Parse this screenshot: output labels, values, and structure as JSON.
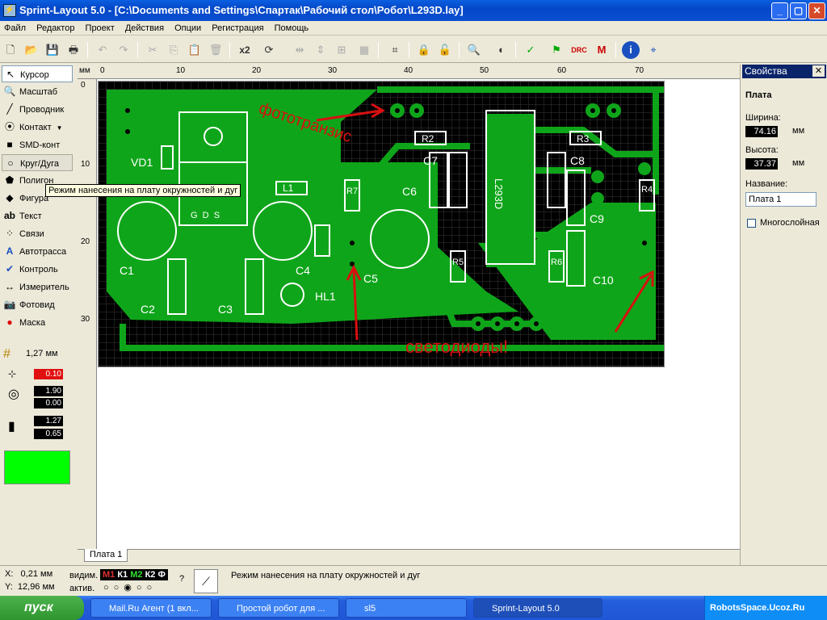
{
  "window": {
    "title": "Sprint-Layout 5.0 - [C:\\Documents and Settings\\Спартак\\Рабочий стол\\Робот\\L293D.lay]",
    "app_icon": "pcb-icon"
  },
  "menu": [
    "Файл",
    "Редактор",
    "Проект",
    "Действия",
    "Опции",
    "Регистрация",
    "Помощь"
  ],
  "toolbar": {
    "zoom_label": "x2"
  },
  "tools": [
    {
      "label": "Курсор",
      "icon": "cursor-icon",
      "glyph": "↖"
    },
    {
      "label": "Масштаб",
      "icon": "zoom-icon",
      "glyph": "🔍"
    },
    {
      "label": "Проводник",
      "icon": "track-icon",
      "glyph": "╱"
    },
    {
      "label": "Контакт",
      "icon": "pad-icon",
      "glyph": "⦿"
    },
    {
      "label": "SMD-конт",
      "icon": "smd-icon",
      "glyph": "■"
    },
    {
      "label": "Круг/Дуга",
      "icon": "circle-icon",
      "glyph": "○"
    },
    {
      "label": "Полигон",
      "icon": "polygon-icon",
      "glyph": "⬟"
    },
    {
      "label": "Фигура",
      "icon": "shape-icon",
      "glyph": "◆"
    },
    {
      "label": "Текст",
      "icon": "text-icon",
      "glyph": "ab"
    },
    {
      "label": "Связи",
      "icon": "connections-icon",
      "glyph": "⁘"
    },
    {
      "label": "Автотрасса",
      "icon": "autoroute-icon",
      "glyph": "A"
    },
    {
      "label": "Контроль",
      "icon": "check-icon",
      "glyph": "✔"
    },
    {
      "label": "Измеритель",
      "icon": "measure-icon",
      "glyph": "↔"
    },
    {
      "label": "Фотовид",
      "icon": "camera-icon",
      "glyph": "📷"
    },
    {
      "label": "Маска",
      "icon": "mask-icon",
      "glyph": "●"
    }
  ],
  "tooltip": "Режим нанесения на плату окружностей и дуг",
  "grid": {
    "value": "1,27 мм"
  },
  "params": {
    "track_width": "0.10",
    "pad_outer": "1.90",
    "pad_inner": "0.00",
    "smd_w": "1.27",
    "smd_h": "0.65"
  },
  "layer_color": "#00ff00",
  "ruler": {
    "unit": "мм",
    "ticks": [
      "0",
      "10",
      "20",
      "30",
      "40",
      "50",
      "60",
      "70"
    ],
    "left_ticks": [
      "0",
      "10",
      "20",
      "30"
    ]
  },
  "properties": {
    "title": "Свойства",
    "section": "Плата",
    "width_label": "Ширина:",
    "width_value": "74.16",
    "width_unit": "мм",
    "height_label": "Высота:",
    "height_value": "37.37",
    "height_unit": "мм",
    "name_label": "Название:",
    "name_value": "Плата 1",
    "multilayer_label": "Многослойная"
  },
  "tab": "Плата 1",
  "status": {
    "x": "X:   0,21 мм",
    "y": "Y:  12,96 мм",
    "visible_label": "видим.",
    "active_label": "актив.",
    "layers": [
      "М1",
      "К1",
      "М2",
      "К2",
      "Ф"
    ],
    "message": "Режим нанесения на плату окружностей и дуг"
  },
  "board_labels": {
    "vd1": "VD1",
    "c1": "C1",
    "c2": "C2",
    "c3": "C3",
    "c4": "C4",
    "c5": "C5",
    "c6": "C6",
    "c7": "C7",
    "c8": "C8",
    "c9": "C9",
    "c10": "C10",
    "r2": "R2",
    "r3": "R3",
    "r4": "R4",
    "r5": "R5",
    "r6": "R6",
    "r7": "R7",
    "l1": "L1",
    "hl1": "HL1",
    "chip": "L293D",
    "gds": "G  D  S",
    "note1": "фототранзис",
    "note2": "светодиоды!"
  },
  "taskbar": {
    "start": "пуск",
    "tasks": [
      "Mail.Ru Агент (1 вкл...",
      "Простой робот для ...",
      "sl5",
      "Sprint-Layout 5.0"
    ],
    "tray": "RobotsSpace.Ucoz.Ru"
  }
}
